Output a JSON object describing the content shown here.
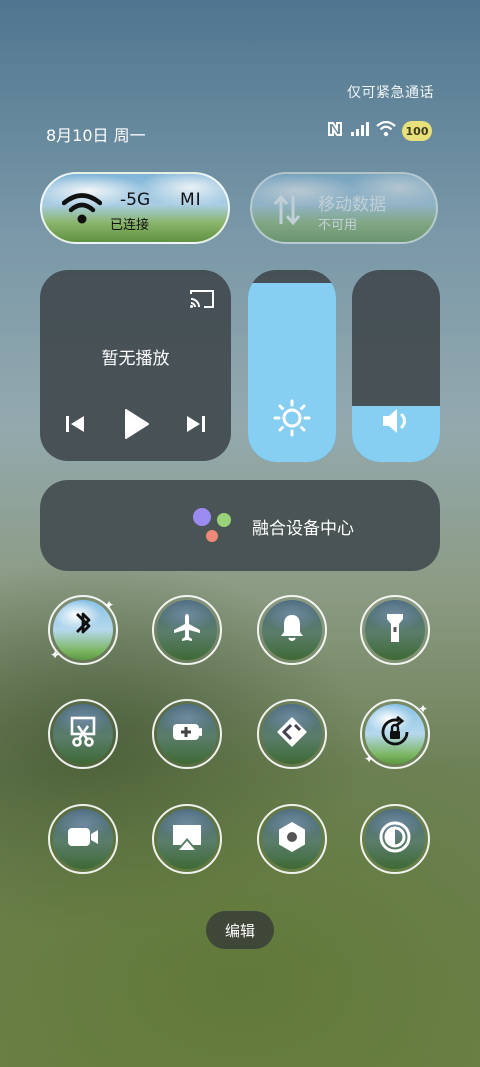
{
  "status": {
    "carrier_text": "仅可紧急通话",
    "date": "8月10日 周一",
    "battery": "100"
  },
  "wifi_card": {
    "ssid_part1": "-5G",
    "ssid_part2": "MI",
    "status": "已连接"
  },
  "data_card": {
    "title": "移动数据",
    "status": "不可用"
  },
  "media": {
    "title": "暂无播放"
  },
  "sliders": {
    "brightness_level": 0.93,
    "volume_level": 0.29
  },
  "fusion": {
    "label": "融合设备中心"
  },
  "toggles": [
    {
      "name": "bluetooth",
      "icon": "bluetooth-icon",
      "on": true
    },
    {
      "name": "airplane",
      "icon": "airplane-icon",
      "on": false
    },
    {
      "name": "ring",
      "icon": "bell-icon",
      "on": false
    },
    {
      "name": "flashlight",
      "icon": "flashlight-icon",
      "on": false
    },
    {
      "name": "screenshot",
      "icon": "scissors-icon",
      "on": false
    },
    {
      "name": "battery-saver",
      "icon": "battery-saver-icon",
      "on": false
    },
    {
      "name": "nearby-share",
      "icon": "share-diamond-icon",
      "on": false
    },
    {
      "name": "rotation-lock",
      "icon": "rotation-lock-icon",
      "on": true
    },
    {
      "name": "screen-record",
      "icon": "video-camera-icon",
      "on": false
    },
    {
      "name": "screen-cast",
      "icon": "screencast-icon",
      "on": false
    },
    {
      "name": "settings",
      "icon": "hex-nut-icon",
      "on": false
    },
    {
      "name": "reading-mode",
      "icon": "contrast-icon",
      "on": false
    }
  ],
  "edit_button": "编辑",
  "colors": {
    "slider_fill": "#86cff2",
    "tile_bg": "#3e464a",
    "battery": "#e8e07a"
  }
}
